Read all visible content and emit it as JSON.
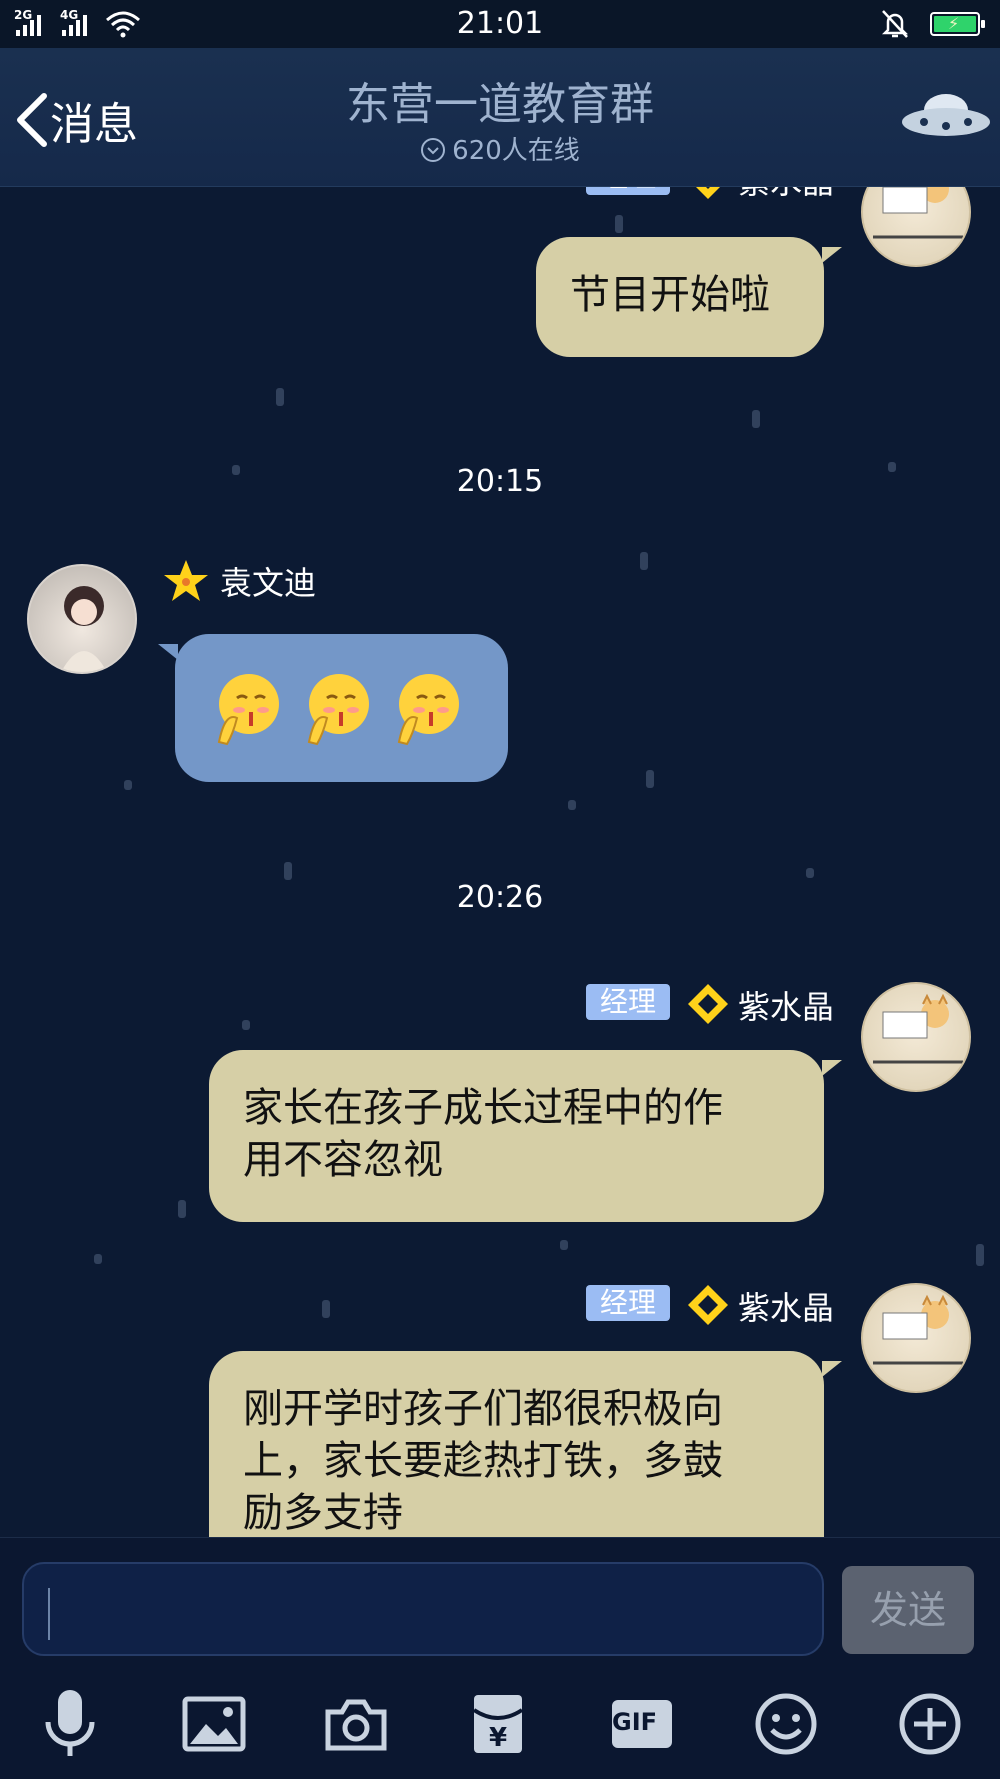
{
  "status_bar": {
    "network_1": "2G",
    "network_2": "4G",
    "time": "21:01"
  },
  "header": {
    "back_label": "消息",
    "title": "东营一道教育群",
    "online_count": "620人在线"
  },
  "messages": [
    {
      "side": "right",
      "role_badge": "经理",
      "sender": "紫水晶",
      "text": "节目开始啦"
    },
    {
      "type": "timestamp",
      "text": "20:15"
    },
    {
      "side": "left",
      "sender": "袁文迪",
      "content": "3 emoji (shushing / hands-together faces)"
    },
    {
      "type": "timestamp",
      "text": "20:26"
    },
    {
      "side": "right",
      "role_badge": "经理",
      "sender": "紫水晶",
      "text_line1": "家长在孩子成长过程中的作",
      "text_line2": "用不容忽视"
    },
    {
      "side": "right",
      "role_badge": "经理",
      "sender": "紫水晶",
      "text_line1": "刚开学时孩子们都很积极向",
      "text_line2": "上，家长要趁热打铁，多鼓",
      "text_line3": "励多支持"
    }
  ],
  "input": {
    "send_label": "发送"
  },
  "toolbar": {
    "gif_label": "GIF"
  },
  "colors": {
    "bubble_right": "#d6cfa6",
    "bubble_left": "#7497c8",
    "badge": "#9bbcf3",
    "background": "#0c1a33"
  }
}
